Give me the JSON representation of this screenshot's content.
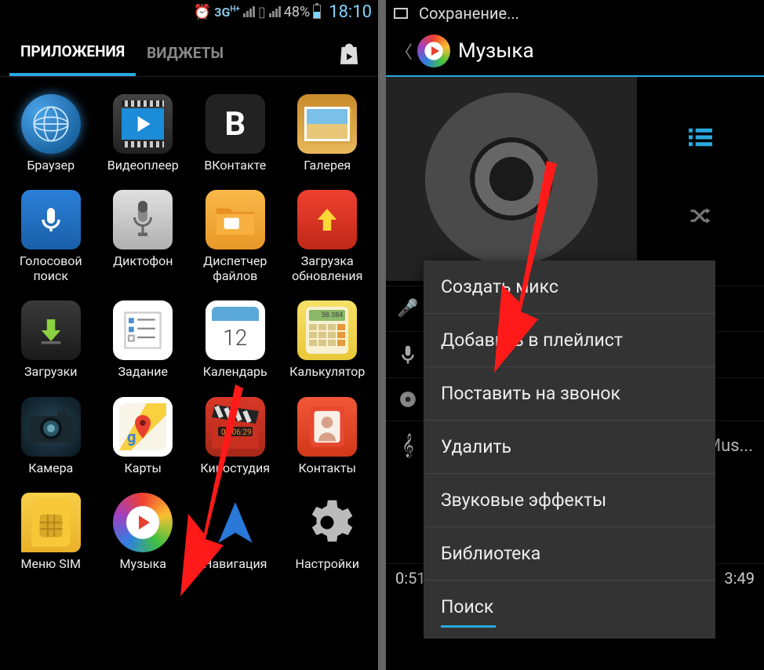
{
  "statusbar": {
    "network": "3G",
    "battery_pct": "48%",
    "time": "18:10"
  },
  "tabs": {
    "apps": "ПРИЛОЖЕНИЯ",
    "widgets": "ВИДЖЕТЫ"
  },
  "apps": {
    "browser": "Браузер",
    "video": "Видеоплеер",
    "vk": "ВКонтакте",
    "vk_letter": "В",
    "gallery": "Галерея",
    "voice": "Голосовой\nпоиск",
    "dict": "Диктофон",
    "files": "Диспетчер\nфайлов",
    "update": "Загрузка\nобновления",
    "downloads": "Загрузки",
    "task": "Задание",
    "calendar": "Календарь",
    "calendar_day": "12",
    "calc": "Калькулятор",
    "calc_display": "58.384",
    "camera": "Камера",
    "maps": "Карты",
    "movie": "Киностудия",
    "movie_tc": "03:06:29",
    "contacts": "Контакты",
    "sim": "Меню SIM",
    "music": "Музыка",
    "nav": "Навигация",
    "settings": "Настройки"
  },
  "right": {
    "status": "Сохранение...",
    "title": "Музыка",
    "menu": {
      "mix": "Создать микс",
      "playlist": "Добавить в плейлист",
      "ringtone": "Поставить на звонок",
      "delete": "Удалить",
      "effects": "Звуковые эффекты",
      "library": "Библиотека",
      "search": "Поиск"
    },
    "bg_partial": "Mus...",
    "time_cur": "0:51",
    "time_total": "3:49"
  }
}
